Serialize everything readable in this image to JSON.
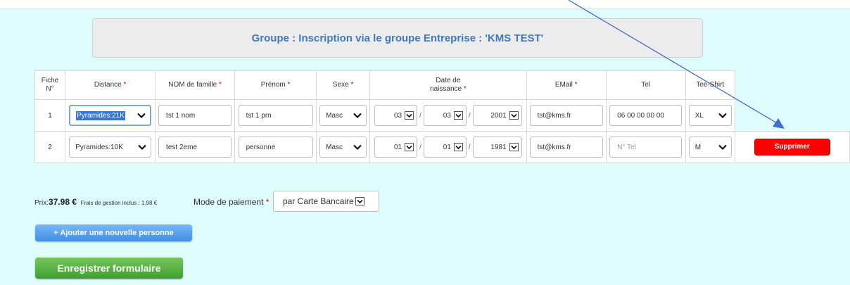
{
  "banner_title": "Groupe : Inscription via le groupe Entreprise : 'KMS TEST'",
  "columns": {
    "fiche_l1": "Fiche",
    "fiche_l2": "N°",
    "distance": "Distance",
    "nom": "NOM de famille",
    "prenom": "Prénom",
    "sexe": "Sexe",
    "date_l1": "Date de",
    "date_l2": "naissance",
    "email": "EMail",
    "tel": "Tel",
    "teeshirt": "Tee-Shirt",
    "required_mark": "*"
  },
  "rows": [
    {
      "num": "1",
      "distance": "Pyramides:21K",
      "nom": "tst 1 nom",
      "prenom": "tst 1 prn",
      "sexe": "Masc",
      "day": "03",
      "month": "03",
      "year": "2001",
      "email": "tst@kms.fr",
      "tel": "06 00 00 00 00",
      "tel_placeholder": "",
      "tshirt": "XL"
    },
    {
      "num": "2",
      "distance": "Pyramides:10K",
      "nom": "test 2eme",
      "prenom": "personne",
      "sexe": "Masc",
      "day": "01",
      "month": "01",
      "year": "1981",
      "email": "tst@kms.fr",
      "tel": "",
      "tel_placeholder": "N° Tel",
      "tshirt": "M",
      "delete_label": "Supprimer"
    }
  ],
  "date_separator": "/",
  "price": {
    "label": "Prix:",
    "value": "37.98 €",
    "fees": "Frais de gestion inclus : 1.98 €"
  },
  "payment": {
    "label": "Mode de paiement",
    "required_mark": "*",
    "selected": "par Carte Bancaire"
  },
  "add_person_label": "+ Ajouter une nouvelle personne",
  "save_label": "Enregistrer formulaire",
  "colors": {
    "background": "#dffcfc",
    "banner_text": "#3f79c3",
    "delete_button": "#ff0000",
    "add_button": "#3d8fe6",
    "save_button": "#3e9f2e",
    "annotation_arrow": "#3a5fc8"
  },
  "icons": [
    "chevron-down-icon",
    "dropdown-arrow-icon",
    "annotation-arrow"
  ]
}
